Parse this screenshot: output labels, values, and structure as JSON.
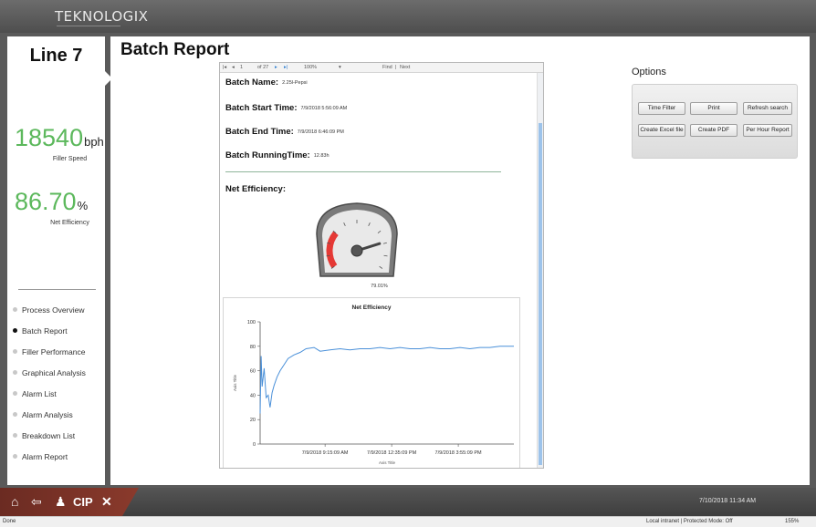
{
  "app": {
    "brand": "TEKNOLOGIX"
  },
  "left": {
    "line_title": "Line 7",
    "filler_speed": {
      "value": "18540",
      "unit": "bph",
      "label": "Filler Speed"
    },
    "net_efficiency": {
      "value": "86.70",
      "unit": "%",
      "label": "Net Efficiency"
    },
    "nav": [
      {
        "label": "Process Overview",
        "active": false
      },
      {
        "label": "Batch Report",
        "active": true
      },
      {
        "label": "Filler Performance",
        "active": false
      },
      {
        "label": "Graphical Analysis",
        "active": false
      },
      {
        "label": "Alarm List",
        "active": false
      },
      {
        "label": "Alarm Analysis",
        "active": false
      },
      {
        "label": "Breakdown List",
        "active": false
      },
      {
        "label": "Alarm Report",
        "active": false
      }
    ]
  },
  "main": {
    "title": "Batch Report",
    "toolbar": {
      "page": "1",
      "of": "of 27",
      "zoom": "100%",
      "find": "Find",
      "next": "Next"
    },
    "report": {
      "batch_name_label": "Batch Name:",
      "batch_name": "2.25l-Pepsi",
      "start_label": "Batch Start Time:",
      "start": "7/9/2018 5:56:09 AM",
      "end_label": "Batch End Time:",
      "end": "7/9/2018 6:46:09 PM",
      "running_label": "Batch RunningTime:",
      "running": "12.83h",
      "net_eff_label": "Net Efficiency:",
      "gauge_value": "79.01%"
    }
  },
  "chart_data": {
    "type": "line",
    "title": "Net Efficiency",
    "xlabel": "Axis Title",
    "ylabel": "Axis Title",
    "ylim": [
      0,
      100
    ],
    "yticks": [
      0,
      20,
      40,
      60,
      80,
      100
    ],
    "xtick_labels": [
      "7/9/2018 9:15:09 AM",
      "7/9/2018 12:35:09 PM",
      "7/9/2018 3:55:09 PM"
    ],
    "x_hours": [
      6.0,
      6.05,
      6.1,
      6.2,
      6.3,
      6.4,
      6.5,
      6.6,
      6.7,
      6.85,
      7.0,
      7.2,
      7.4,
      7.7,
      8.0,
      8.3,
      8.7,
      9.0,
      9.5,
      10.0,
      10.5,
      11.0,
      11.5,
      12.0,
      12.5,
      13.0,
      13.5,
      14.0,
      14.5,
      15.0,
      15.5,
      16.0,
      16.5,
      17.0,
      17.5,
      18.0,
      18.7
    ],
    "values": [
      25,
      72,
      47,
      62,
      38,
      40,
      30,
      42,
      48,
      55,
      60,
      65,
      70,
      73,
      75,
      78,
      79,
      76,
      77,
      78,
      77,
      78,
      78,
      79,
      78,
      79,
      78,
      78,
      79,
      78,
      78,
      79,
      78,
      79,
      79,
      80,
      80
    ],
    "grid": false,
    "gauge": {
      "value": 79.01,
      "min": 0,
      "max": 100
    }
  },
  "options": {
    "title": "Options",
    "buttons": [
      "Time Filter",
      "Print",
      "Refresh search",
      "Create Excel file",
      "Create PDF",
      "Per Hour Report"
    ]
  },
  "bottom": {
    "cip": "CIP",
    "datetime": "7/10/2018    11:34 AM"
  },
  "status": {
    "left": "Done",
    "right": "Local intranet | Protected Mode: Off",
    "zoom": "155%"
  }
}
